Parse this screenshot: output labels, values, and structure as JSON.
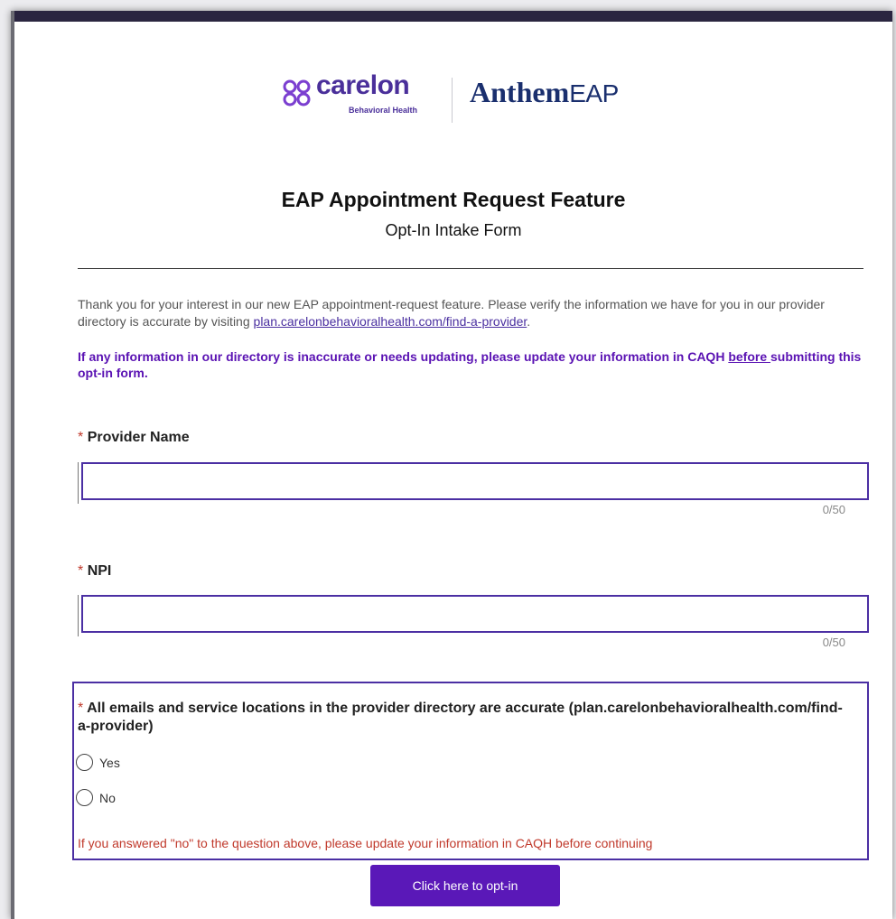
{
  "logos": {
    "carelon_name": "carelon",
    "carelon_sub": "Behavioral Health",
    "anthem_name": "Anthem",
    "anthem_suffix": "EAP"
  },
  "form": {
    "title": "EAP Appointment Request Feature",
    "subtitle": "Opt-In Intake Form",
    "intro_text": "Thank you for your interest in our new EAP appointment-request feature. Please verify the information we have for you in our provider directory is accurate by visiting ",
    "intro_link": "plan.carelonbehavioralhealth.com/find-a-provider",
    "intro_end": ".",
    "warning_part1": "If any information in our directory is inaccurate or needs updating, please update your information in CAQH ",
    "warning_underlined": "before ",
    "warning_part2": "submitting this opt-in form.",
    "required_marker": "*",
    "fields": [
      {
        "label": "Provider Name",
        "value": "",
        "counter": "0/50"
      },
      {
        "label": "NPI",
        "value": "",
        "counter": "0/50"
      }
    ],
    "question": {
      "label": "All emails and service locations in the provider directory are accurate (plan.carelonbehavioralhealth.com/find-a-provider)",
      "options": [
        "Yes",
        "No"
      ],
      "note": "If you answered \"no\" to the question above, please update your information in CAQH before continuing"
    },
    "submit_label": "Click here to opt-in"
  },
  "colors": {
    "accent": "#4b2fa3",
    "button": "#5a18b8",
    "required": "#c0392b",
    "topbar": "#2a2540"
  }
}
